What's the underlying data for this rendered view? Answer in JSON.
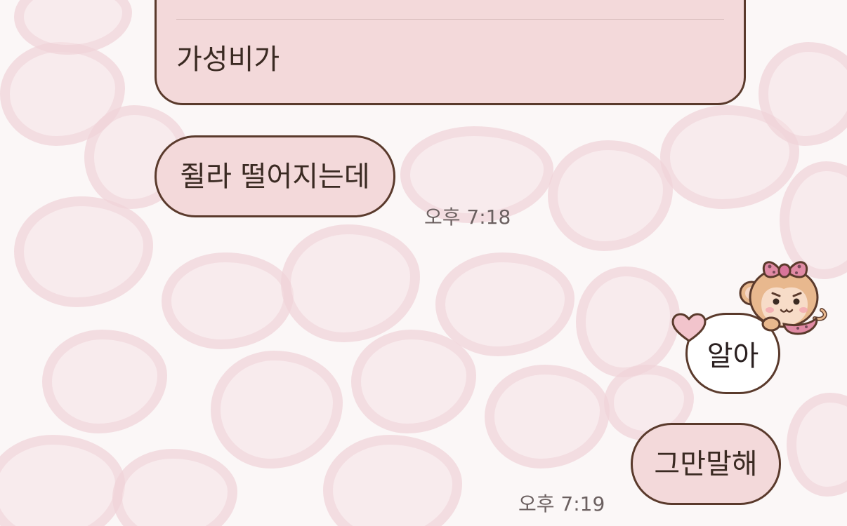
{
  "messages": {
    "prev_bubble_text": "가성비가",
    "received_text": "쥘라 떨어지는데",
    "received_time": "오후 7:18",
    "sent_sticker_text": "알아",
    "sent_text": "그만말해",
    "sent_time": "오후 7:19"
  },
  "icons": {
    "heart": "heart-icon",
    "sticker": "monkey-sticker-icon"
  },
  "colors": {
    "bubble_fill": "#f3d9da",
    "bubble_border": "#5a3a2c",
    "time_text": "#6b6060"
  }
}
